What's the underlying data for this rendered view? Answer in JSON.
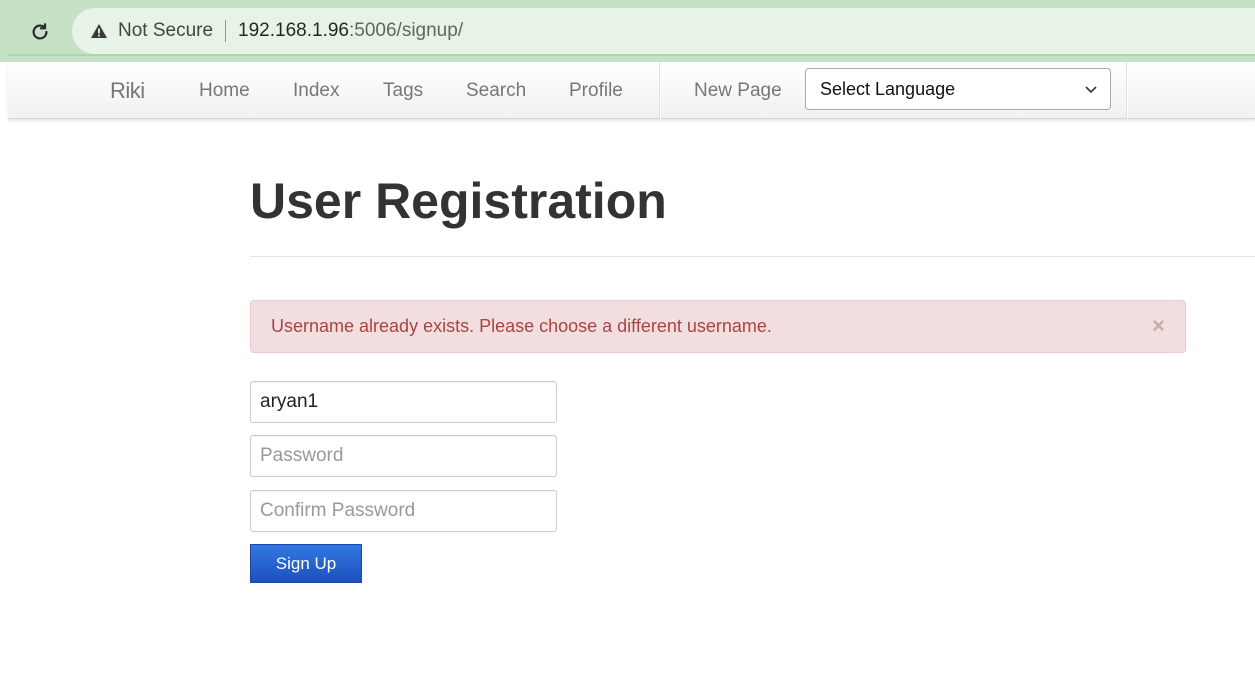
{
  "browser": {
    "security_label": "Not Secure",
    "url_host": "192.168.1.96",
    "url_path": ":5006/signup/"
  },
  "navbar": {
    "brand": "Riki",
    "items": [
      "Home",
      "Index",
      "Tags",
      "Search",
      "Profile",
      "New Page"
    ],
    "language_select": "Select Language"
  },
  "page": {
    "title": "User Registration"
  },
  "alert": {
    "message": "Username already exists. Please choose a different username.",
    "close": "×"
  },
  "form": {
    "username_value": "aryan1",
    "password_placeholder": "Password",
    "confirm_placeholder": "Confirm Password",
    "submit_label": "Sign Up"
  },
  "colors": {
    "browser_bar": "#c7e1c6",
    "alert_bg": "#f2dede",
    "alert_text": "#a94442",
    "button": "#2563d0"
  },
  "icons": [
    "reload-icon",
    "warning-icon",
    "chevron-down-icon",
    "close-icon"
  ]
}
